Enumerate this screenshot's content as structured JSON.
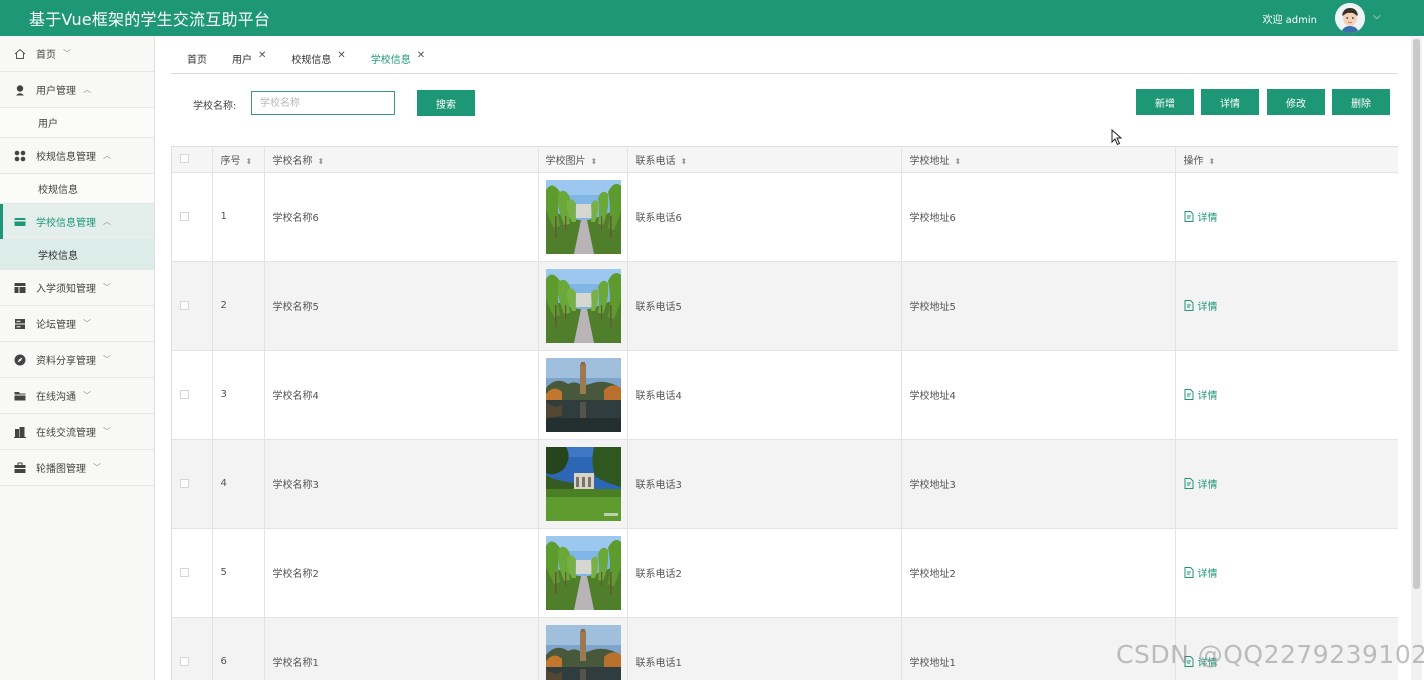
{
  "header": {
    "title": "基于Vue框架的学生交流互助平台",
    "welcome": "欢迎 admin"
  },
  "sidebar": {
    "items": [
      {
        "label": "首页",
        "icon": "home-icon"
      },
      {
        "label": "用户管理",
        "icon": "user-icon",
        "sub": [
          "用户"
        ]
      },
      {
        "label": "校规信息管理",
        "icon": "apps-icon",
        "sub": [
          "校规信息"
        ]
      },
      {
        "label": "学校信息管理",
        "icon": "card-icon",
        "sub": [
          "学校信息"
        ],
        "active": true
      },
      {
        "label": "入学须知管理",
        "icon": "layout-icon"
      },
      {
        "label": "论坛管理",
        "icon": "server-icon"
      },
      {
        "label": "资料分享管理",
        "icon": "compass-icon"
      },
      {
        "label": "在线沟通",
        "icon": "folder-icon"
      },
      {
        "label": "在线交流管理",
        "icon": "building-icon"
      },
      {
        "label": "轮播图管理",
        "icon": "briefcase-icon"
      }
    ]
  },
  "tabs": [
    {
      "label": "首页",
      "closable": false
    },
    {
      "label": "用户",
      "closable": true
    },
    {
      "label": "校规信息",
      "closable": true
    },
    {
      "label": "学校信息",
      "closable": true,
      "active": true
    }
  ],
  "search": {
    "label": "学校名称:",
    "placeholder": "学校名称",
    "button": "搜索"
  },
  "toolbar": {
    "add": "新增",
    "detail": "详情",
    "edit": "修改",
    "delete": "删除"
  },
  "table": {
    "headers": {
      "index": "序号",
      "name": "学校名称",
      "image": "学校图片",
      "phone": "联系电话",
      "address": "学校地址",
      "ops": "操作"
    },
    "rows": [
      {
        "index": "1",
        "name": "学校名称6",
        "image": "tree-avenue",
        "phone": "联系电话6",
        "address": "学校地址6",
        "op": "详情"
      },
      {
        "index": "2",
        "name": "学校名称5",
        "image": "tree-avenue",
        "phone": "联系电话5",
        "address": "学校地址5",
        "op": "详情"
      },
      {
        "index": "3",
        "name": "学校名称4",
        "image": "lake-tower",
        "phone": "联系电话4",
        "address": "学校地址4",
        "op": "详情"
      },
      {
        "index": "4",
        "name": "学校名称3",
        "image": "campus-lawn",
        "phone": "联系电话3",
        "address": "学校地址3",
        "op": "详情"
      },
      {
        "index": "5",
        "name": "学校名称2",
        "image": "tree-avenue",
        "phone": "联系电话2",
        "address": "学校地址2",
        "op": "详情"
      },
      {
        "index": "6",
        "name": "学校名称1",
        "image": "lake-tower",
        "phone": "联系电话1",
        "address": "学校地址1",
        "op": "详情"
      }
    ]
  },
  "watermark": "CSDN @QQ2279239102",
  "colors": {
    "primary": "#1e9777",
    "sidebar_active_bg": "#e4efec"
  }
}
